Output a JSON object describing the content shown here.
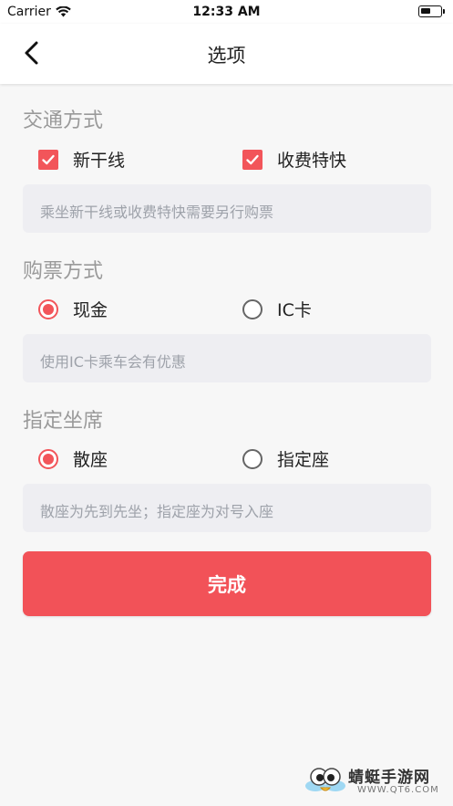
{
  "status_bar": {
    "carrier": "Carrier",
    "time": "12:33 AM"
  },
  "nav": {
    "title": "选项"
  },
  "transport": {
    "title": "交通方式",
    "options": [
      {
        "label": "新干线",
        "checked": true
      },
      {
        "label": "收费特快",
        "checked": true
      }
    ],
    "note": "乘坐新干线或收费特快需要另行购票"
  },
  "ticket": {
    "title": "购票方式",
    "options": [
      {
        "label": "现金",
        "selected": true
      },
      {
        "label": "IC卡",
        "selected": false
      }
    ],
    "note": "使用IC卡乘车会有优惠"
  },
  "seat": {
    "title": "指定坐席",
    "options": [
      {
        "label": "散座",
        "selected": true
      },
      {
        "label": "指定座",
        "selected": false
      }
    ],
    "note": "散座为先到先坐；指定座为对号入座"
  },
  "done_label": "完成",
  "watermark": {
    "name": "蜻蜓手游网",
    "url": "WWW.QT6.COM"
  },
  "colors": {
    "accent": "#f2555a",
    "note_bg": "#eeeef2",
    "section_title": "#9a9a9a"
  }
}
